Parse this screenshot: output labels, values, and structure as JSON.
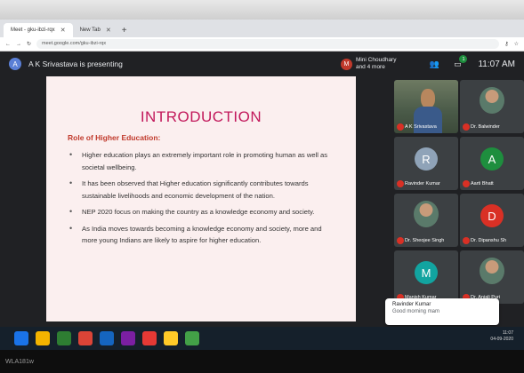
{
  "browser": {
    "tabs": [
      {
        "label": "Meet - gku-ibzi-rqx",
        "active": true
      },
      {
        "label": "New Tab",
        "active": false
      }
    ],
    "url": "meet.google.com/gku-ibzi-rqx"
  },
  "meet": {
    "presenter_initial": "A",
    "presenting_text": "A K Srivastava is presenting",
    "mini_initial": "M",
    "mini_name_line1": "Mini Choudhary",
    "mini_name_line2": "and 4 more",
    "chat_badge": "1",
    "clock": "11:07 AM"
  },
  "slide": {
    "title": "INTRODUCTION",
    "subtitle": "Role of Higher Education:",
    "bullets": [
      "Higher education plays an extremely important role in promoting human as well as societal wellbeing.",
      "It has been observed that Higher education significantly contributes towards sustainable livelihoods and economic development of the nation.",
      "NEP 2020 focus on making the country as a knowledge economy and society.",
      "As India moves towards becoming a knowledge economy and society, more and more young Indians are likely to aspire for higher education."
    ]
  },
  "participants": [
    {
      "name": "A K Srivastava",
      "initial": "",
      "color": "#4a5a48",
      "kind": "video"
    },
    {
      "name": "Dr. Balwinder",
      "initial": "",
      "color": "#3c4043",
      "kind": "photo"
    },
    {
      "name": "Ravinder Kumar",
      "initial": "R",
      "color": "#8fa3b8",
      "kind": "initial"
    },
    {
      "name": "Aarti Bhatt",
      "initial": "A",
      "color": "#1e8e3e",
      "kind": "initial"
    },
    {
      "name": "Dr. Sheojee Singh",
      "initial": "",
      "color": "#3c4043",
      "kind": "photo"
    },
    {
      "name": "Dr. Dipanshu Sh",
      "initial": "D",
      "color": "#d93025",
      "kind": "initial"
    },
    {
      "name": "Manish Kumar",
      "initial": "M",
      "color": "#12a4a0",
      "kind": "initial"
    },
    {
      "name": "Dr. Anjali Puri",
      "initial": "",
      "color": "#3c4043",
      "kind": "photo"
    }
  ],
  "toast": {
    "name": "Ravinder Kumar",
    "message": "Good morning mam"
  },
  "taskbar_colors": [
    "#1a73e8",
    "#f4b400",
    "#2e7d32",
    "#db4437",
    "#1565c0",
    "#7b1fa2",
    "#e53935",
    "#ffca28",
    "#43a047"
  ],
  "tray": {
    "time": "11:07",
    "date": "04-09-2020"
  },
  "bezel_label": "WLA181w"
}
